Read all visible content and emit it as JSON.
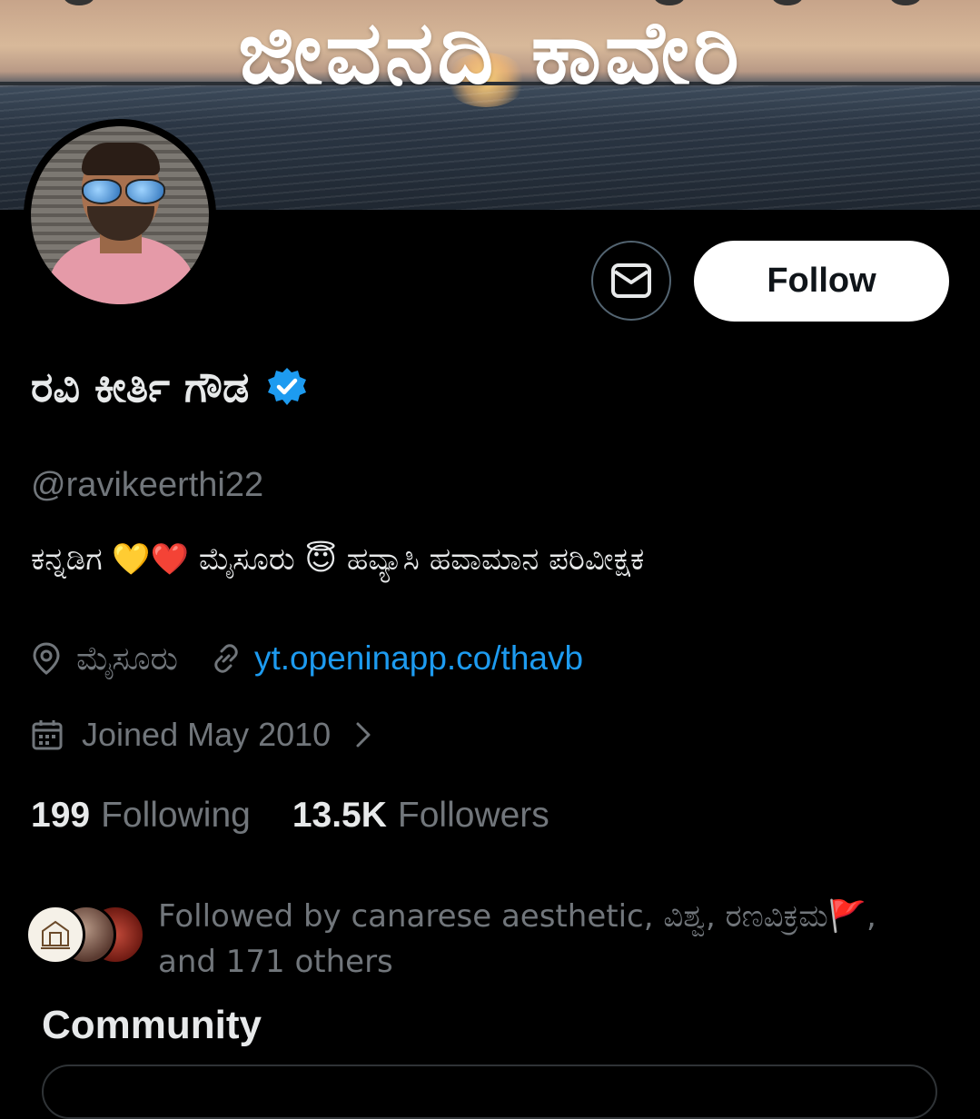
{
  "banner": {
    "title": "ಜೀವನದಿ ಕಾವೇರಿ"
  },
  "profile": {
    "name": "ರವಿ ಕೀರ್ತಿ ಗೌಡ",
    "handle": "@ravikeerthi22",
    "bio": "ಕನ್ನಡಿಗ 💛❤️ ಮೈಸೂರು 😇 ಹವ್ಯಾಸಿ ಹವಾಮಾನ ಪರಿವೀಕ್ಷಕ",
    "location": "ಮೈಸೂರು",
    "link": "yt.openinapp.co/thavb",
    "joined": "Joined May 2010"
  },
  "actions": {
    "follow_label": "Follow"
  },
  "stats": {
    "following_count": "199",
    "following_label": "Following",
    "followers_count": "13.5K",
    "followers_label": "Followers"
  },
  "followed_by": {
    "text_line1": "Followed by canarese aesthetic, ವಿಶ್ವ, ರಣವಿಕ್ರಮ🚩,",
    "text_line2": "and 171 others"
  },
  "community": {
    "heading": "Community"
  },
  "colors": {
    "accent": "#1d9bf0",
    "background": "#000000",
    "muted": "#71767b"
  }
}
